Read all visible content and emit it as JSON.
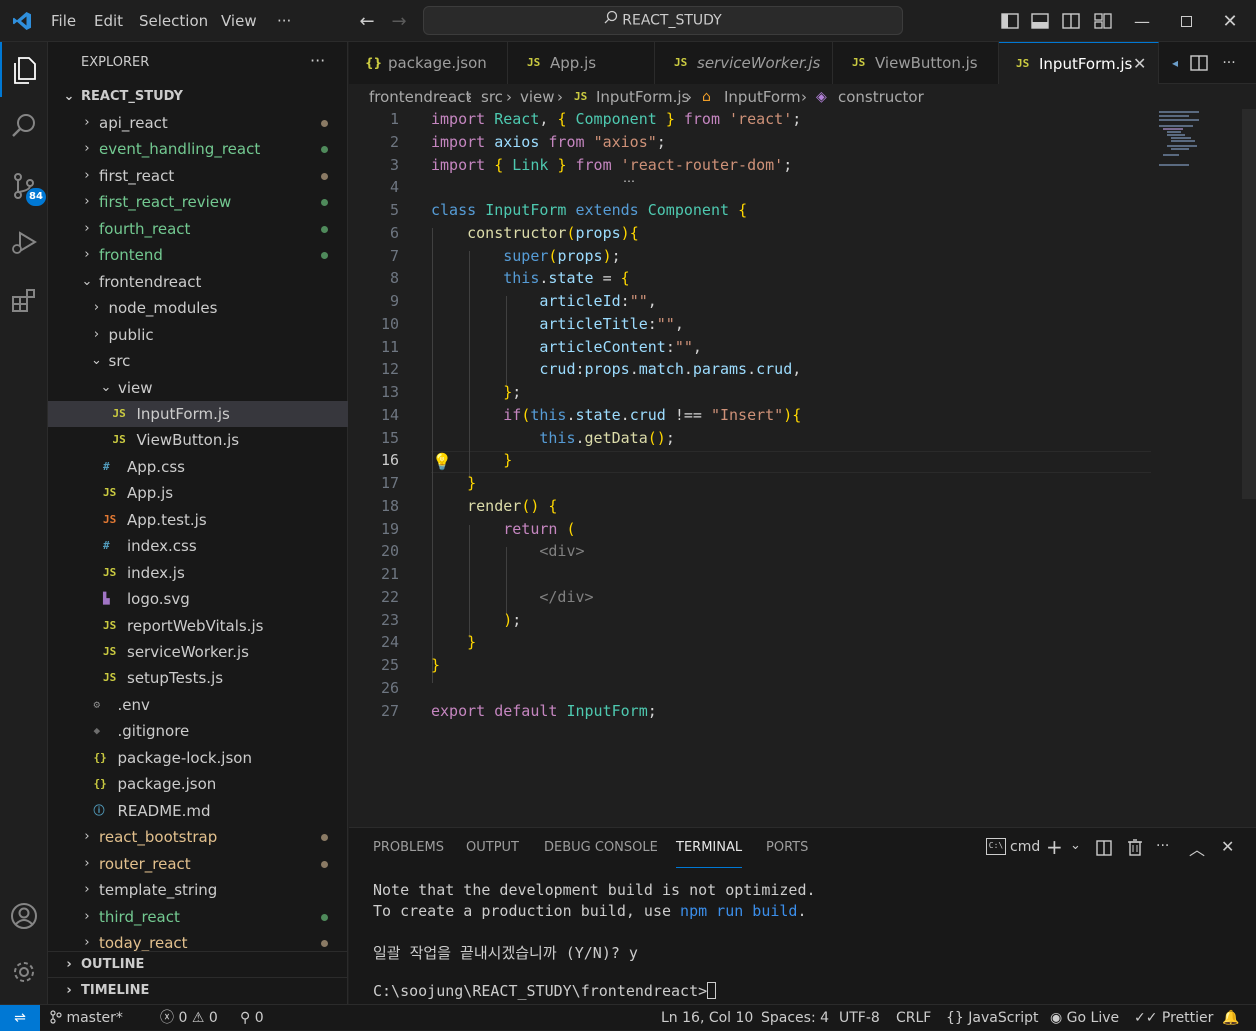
{
  "titlebar": {
    "menus": [
      "File",
      "Edit",
      "Selection",
      "View",
      "···"
    ],
    "command_center": "REACT_STUDY"
  },
  "activity": {
    "source_control_badge": "84"
  },
  "sidebar": {
    "title": "EXPLORER",
    "more": "···",
    "root": "REACT_STUDY",
    "items": [
      {
        "label": "api_react",
        "level": 0,
        "kind": "folder",
        "open": false,
        "dot": "#8a7a64",
        "color": "#cccccc"
      },
      {
        "label": "event_handling_react",
        "level": 0,
        "kind": "folder",
        "open": false,
        "dot": "#4f8a5b",
        "color": "#73c991"
      },
      {
        "label": "first_react",
        "level": 0,
        "kind": "folder",
        "open": false,
        "dot": "#8a7a64",
        "color": "#cccccc"
      },
      {
        "label": "first_react_review",
        "level": 0,
        "kind": "folder",
        "open": false,
        "dot": "#4f8a5b",
        "color": "#73c991"
      },
      {
        "label": "fourth_react",
        "level": 0,
        "kind": "folder",
        "open": false,
        "dot": "#4f8a5b",
        "color": "#73c991"
      },
      {
        "label": "frontend",
        "level": 0,
        "kind": "folder",
        "open": false,
        "dot": "#4f8a5b",
        "color": "#73c991"
      },
      {
        "label": "frontendreact",
        "level": 0,
        "kind": "folder",
        "open": true,
        "dot": "",
        "color": "#cccccc"
      },
      {
        "label": "node_modules",
        "level": 1,
        "kind": "folder",
        "open": false,
        "dot": "",
        "color": "#cccccc"
      },
      {
        "label": "public",
        "level": 1,
        "kind": "folder",
        "open": false,
        "dot": "",
        "color": "#cccccc"
      },
      {
        "label": "src",
        "level": 1,
        "kind": "folder",
        "open": true,
        "dot": "",
        "color": "#cccccc"
      },
      {
        "label": "view",
        "level": 2,
        "kind": "folder",
        "open": true,
        "dot": "",
        "color": "#cccccc"
      },
      {
        "label": "InputForm.js",
        "level": 3,
        "kind": "js",
        "dot": "",
        "color": "#cccccc",
        "selected": true
      },
      {
        "label": "ViewButton.js",
        "level": 3,
        "kind": "js",
        "dot": "",
        "color": "#cccccc"
      },
      {
        "label": "App.css",
        "level": 2,
        "kind": "css",
        "dot": "",
        "color": "#cccccc"
      },
      {
        "label": "App.js",
        "level": 2,
        "kind": "js",
        "dot": "",
        "color": "#cccccc"
      },
      {
        "label": "App.test.js",
        "level": 2,
        "kind": "jstest",
        "dot": "",
        "color": "#cccccc"
      },
      {
        "label": "index.css",
        "level": 2,
        "kind": "css",
        "dot": "",
        "color": "#cccccc"
      },
      {
        "label": "index.js",
        "level": 2,
        "kind": "js",
        "dot": "",
        "color": "#cccccc"
      },
      {
        "label": "logo.svg",
        "level": 2,
        "kind": "svg",
        "dot": "",
        "color": "#cccccc"
      },
      {
        "label": "reportWebVitals.js",
        "level": 2,
        "kind": "js",
        "dot": "",
        "color": "#cccccc"
      },
      {
        "label": "serviceWorker.js",
        "level": 2,
        "kind": "js",
        "dot": "",
        "color": "#cccccc"
      },
      {
        "label": "setupTests.js",
        "level": 2,
        "kind": "js",
        "dot": "",
        "color": "#cccccc"
      },
      {
        "label": ".env",
        "level": 1,
        "kind": "env",
        "dot": "",
        "color": "#cccccc"
      },
      {
        "label": ".gitignore",
        "level": 1,
        "kind": "git",
        "dot": "",
        "color": "#cccccc"
      },
      {
        "label": "package-lock.json",
        "level": 1,
        "kind": "json",
        "dot": "",
        "color": "#cccccc"
      },
      {
        "label": "package.json",
        "level": 1,
        "kind": "json",
        "dot": "",
        "color": "#cccccc"
      },
      {
        "label": "README.md",
        "level": 1,
        "kind": "info",
        "dot": "",
        "color": "#cccccc"
      },
      {
        "label": "react_bootstrap",
        "level": 0,
        "kind": "folder",
        "open": false,
        "dot": "#8a7a64",
        "color": "#e2c08d"
      },
      {
        "label": "router_react",
        "level": 0,
        "kind": "folder",
        "open": false,
        "dot": "#8a7a64",
        "color": "#e2c08d"
      },
      {
        "label": "template_string",
        "level": 0,
        "kind": "folder",
        "open": false,
        "dot": "",
        "color": "#cccccc"
      },
      {
        "label": "third_react",
        "level": 0,
        "kind": "folder",
        "open": false,
        "dot": "#4f8a5b",
        "color": "#73c991"
      },
      {
        "label": "today_react",
        "level": 0,
        "kind": "folder",
        "open": false,
        "dot": "#8a7a64",
        "color": "#e2c08d"
      }
    ],
    "outline": "OUTLINE",
    "timeline": "TIMELINE"
  },
  "tabs": [
    {
      "label": "package.json",
      "icon": "{}",
      "italic": false,
      "active": false
    },
    {
      "label": "App.js",
      "icon": "JS",
      "italic": false,
      "active": false
    },
    {
      "label": "serviceWorker.js",
      "icon": "JS",
      "italic": true,
      "active": false
    },
    {
      "label": "ViewButton.js",
      "icon": "JS",
      "italic": false,
      "active": false
    },
    {
      "label": "InputForm.js",
      "icon": "JS",
      "italic": false,
      "active": true
    }
  ],
  "breadcrumb": [
    "frontendreact",
    "src",
    "view",
    "InputForm.js",
    "InputForm",
    "constructor"
  ],
  "editor": {
    "current_line": 16,
    "lines": [
      "import React, { Component } from 'react';",
      "import axios from \"axios\";",
      "import { Link } from 'react-router-dom';",
      "",
      "class InputForm extends Component {",
      "    constructor(props){",
      "        super(props);",
      "        this.state = {",
      "            articleId:\"\",",
      "            articleTitle:\"\",",
      "            articleContent:\"\",",
      "            crud:props.match.params.crud,",
      "        };",
      "        if(this.state.crud !== \"Insert\"){",
      "            this.getData();",
      "        }",
      "    }",
      "    render() {",
      "        return (",
      "            <div>",
      "",
      "            </div>",
      "        );",
      "    }",
      "}",
      "",
      "export default InputForm;"
    ]
  },
  "panel": {
    "tabs": [
      "PROBLEMS",
      "OUTPUT",
      "DEBUG CONSOLE",
      "TERMINAL",
      "PORTS"
    ],
    "active_tab": "TERMINAL",
    "shell": "cmd",
    "terminal": {
      "line1": "Note that the development build is not optimized.",
      "line2_prefix": "To create a production build, use ",
      "line2_cmd": "npm run build",
      "line2_suffix": ".",
      "line3": "일괄 작업을 끝내시겠습니까 (Y/N)? y",
      "line4": "C:\\soojung\\REACT_STUDY\\frontendreact>"
    }
  },
  "status": {
    "branch": "master*",
    "errors": "0",
    "warnings": "0",
    "ports": "0",
    "position": "Ln 16, Col 10",
    "spaces": "Spaces: 4",
    "encoding": "UTF-8",
    "eol": "CRLF",
    "language": "JavaScript",
    "golive": "Go Live",
    "prettier": "Prettier"
  }
}
